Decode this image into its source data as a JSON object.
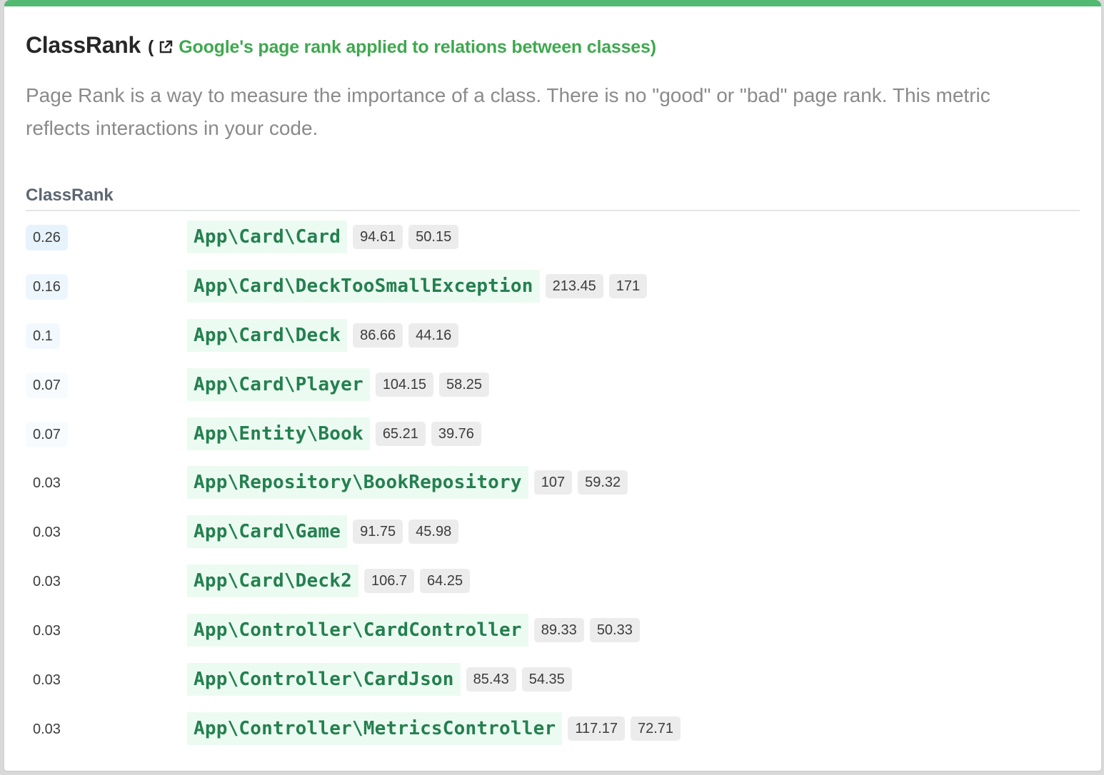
{
  "header": {
    "title": "ClassRank",
    "paren_open": "(",
    "link_text": "Google's page rank applied to relations between classes)",
    "description": "Page Rank is a way to measure the importance of a class. There is no \"good\" or \"bad\" page rank. This metric reflects interactions in your code."
  },
  "table": {
    "column_header": "ClassRank",
    "rows": [
      {
        "rank": "0.26",
        "class": "App\\Card\\Card",
        "m1": "94.61",
        "m2": "50.15",
        "rank_bg": "#e6f3fc"
      },
      {
        "rank": "0.16",
        "class": "App\\Card\\DeckTooSmallException",
        "m1": "213.45",
        "m2": "171",
        "rank_bg": "#edf6fd"
      },
      {
        "rank": "0.1",
        "class": "App\\Card\\Deck",
        "m1": "86.66",
        "m2": "44.16",
        "rank_bg": "#f2f9fe"
      },
      {
        "rank": "0.07",
        "class": "App\\Card\\Player",
        "m1": "104.15",
        "m2": "58.25",
        "rank_bg": "#f7fbfe"
      },
      {
        "rank": "0.07",
        "class": "App\\Entity\\Book",
        "m1": "65.21",
        "m2": "39.76",
        "rank_bg": "#f7fbfe"
      },
      {
        "rank": "0.03",
        "class": "App\\Repository\\BookRepository",
        "m1": "107",
        "m2": "59.32",
        "rank_bg": "#ffffff"
      },
      {
        "rank": "0.03",
        "class": "App\\Card\\Game",
        "m1": "91.75",
        "m2": "45.98",
        "rank_bg": "#ffffff"
      },
      {
        "rank": "0.03",
        "class": "App\\Card\\Deck2",
        "m1": "106.7",
        "m2": "64.25",
        "rank_bg": "#ffffff"
      },
      {
        "rank": "0.03",
        "class": "App\\Controller\\CardController",
        "m1": "89.33",
        "m2": "50.33",
        "rank_bg": "#ffffff"
      },
      {
        "rank": "0.03",
        "class": "App\\Controller\\CardJson",
        "m1": "85.43",
        "m2": "54.35",
        "rank_bg": "#ffffff"
      },
      {
        "rank": "0.03",
        "class": "App\\Controller\\MetricsController",
        "m1": "117.17",
        "m2": "72.71",
        "rank_bg": "#ffffff"
      }
    ]
  },
  "colors": {
    "accent": "#52b973",
    "link": "#3fa84f",
    "class_text": "#24804f",
    "class_bg": "#ecfbf1",
    "badge_bg": "#ececec"
  },
  "icons": {
    "external_link": "external-link-icon"
  }
}
